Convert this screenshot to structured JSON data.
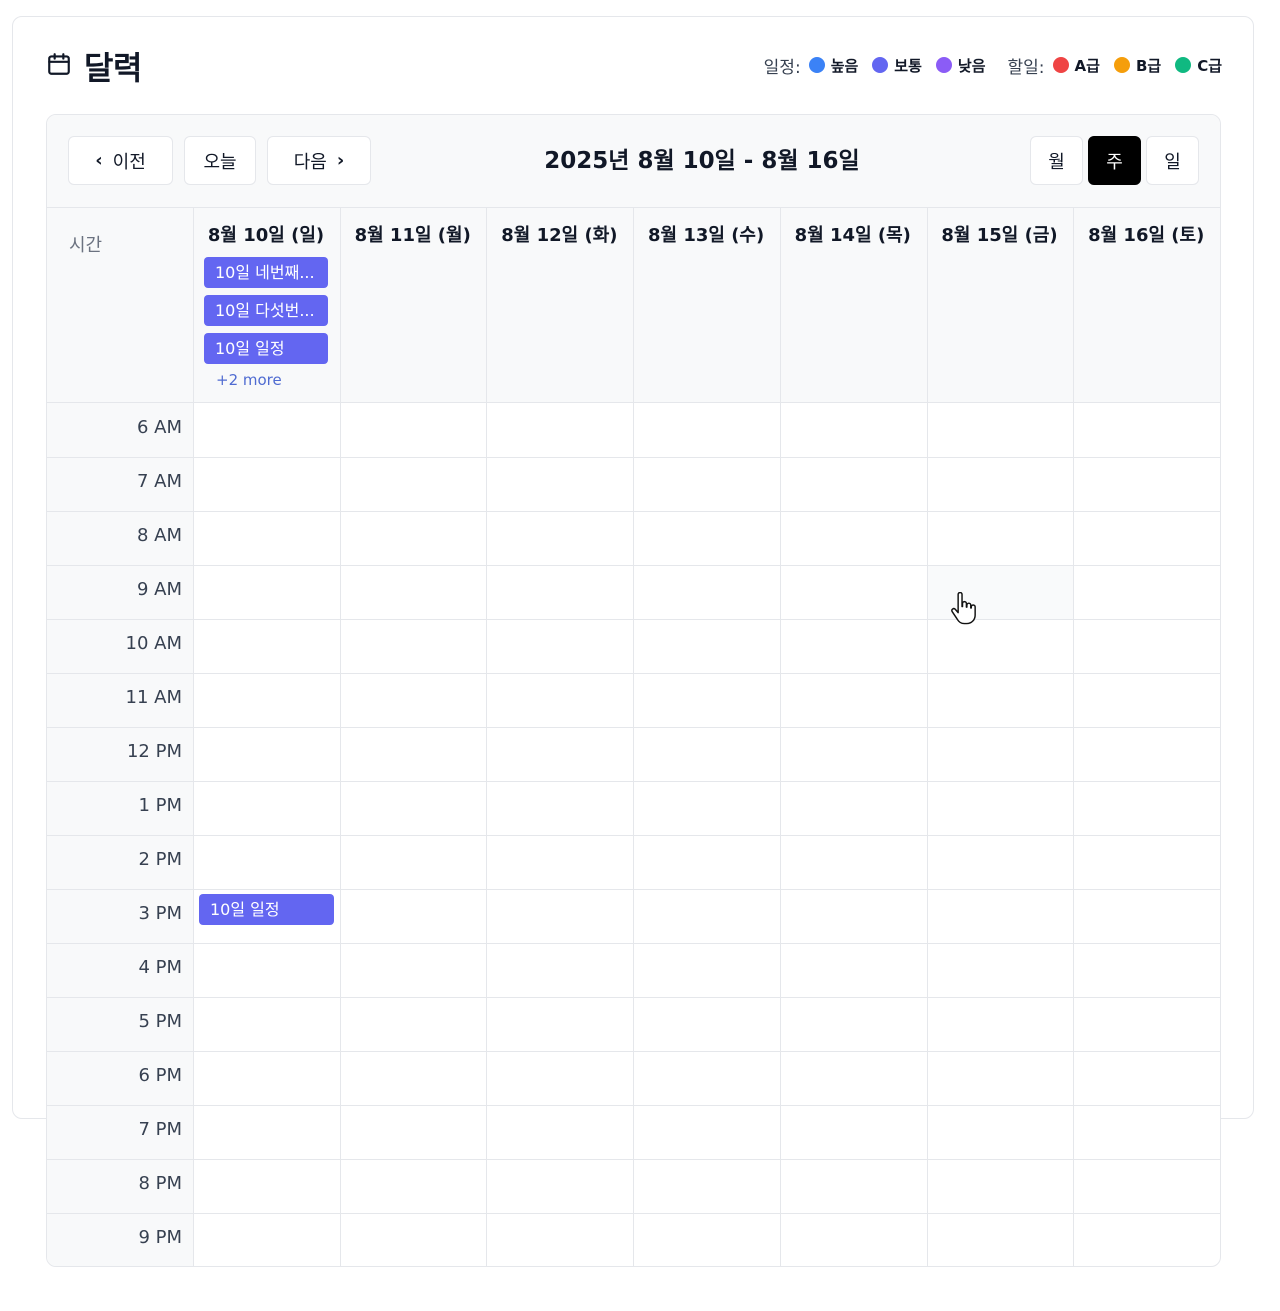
{
  "header": {
    "title": "달력",
    "legend": {
      "schedule_label": "일정:",
      "schedule_items": [
        {
          "label": "높음",
          "color": "#3b82f6"
        },
        {
          "label": "보통",
          "color": "#6366f1"
        },
        {
          "label": "낮음",
          "color": "#8b5cf6"
        }
      ],
      "todo_label": "할일:",
      "todo_items": [
        {
          "label": "A급",
          "color": "#ef4444"
        },
        {
          "label": "B급",
          "color": "#f59e0b"
        },
        {
          "label": "C급",
          "color": "#10b981"
        }
      ]
    }
  },
  "toolbar": {
    "prev_label": "이전",
    "today_label": "오늘",
    "next_label": "다음",
    "range_label": "2025년 8월 10일 - 8월 16일",
    "views": {
      "month": "월",
      "week": "주",
      "day": "일"
    },
    "active_view": "week"
  },
  "grid": {
    "time_header": "시간",
    "days": [
      "8월 10일 (일)",
      "8월 11일 (월)",
      "8월 12일 (화)",
      "8월 13일 (수)",
      "8월 14일 (목)",
      "8월 15일 (금)",
      "8월 16일 (토)"
    ],
    "all_day_events": [
      {
        "label": "10일 네번째..."
      },
      {
        "label": "10일 다섯번..."
      },
      {
        "label": "10일 일정"
      }
    ],
    "more_label": "+2 more",
    "hours": [
      "6 AM",
      "7 AM",
      "8 AM",
      "9 AM",
      "10 AM",
      "11 AM",
      "12 PM",
      "1 PM",
      "2 PM",
      "3 PM",
      "4 PM",
      "5 PM",
      "6 PM",
      "7 PM",
      "8 PM",
      "9 PM"
    ],
    "timed_event": {
      "label": "10일 일정",
      "day": "8월 10일 (일)",
      "hour": "3 PM"
    }
  },
  "colors": {
    "event": "#6366f1",
    "active_view_bg": "#000000"
  }
}
